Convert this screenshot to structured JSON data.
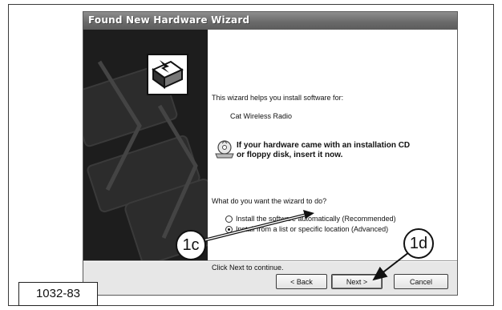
{
  "window": {
    "title": "Found New Hardware Wizard"
  },
  "content": {
    "intro": "This wizard helps you install software for:",
    "device": "Cat Wireless Radio",
    "cd_message_line1": "If your hardware came with an installation CD",
    "cd_message_line2": "or floppy disk, insert it now.",
    "question": "What do you want the wizard to do?",
    "options": [
      {
        "label": "Install the software automatically (Recommended)",
        "selected": false
      },
      {
        "label": "Install from a list or specific location (Advanced)",
        "selected": true
      }
    ],
    "continue_text": "Click Next to continue."
  },
  "buttons": {
    "back": "< Back",
    "next": "Next >",
    "cancel": "Cancel"
  },
  "callouts": {
    "c1c": "1c",
    "c1d": "1d"
  },
  "figure_label": "1032-83",
  "icons": {
    "wizard": "hardware-wizard-icon",
    "cd": "cd-drive-icon"
  }
}
